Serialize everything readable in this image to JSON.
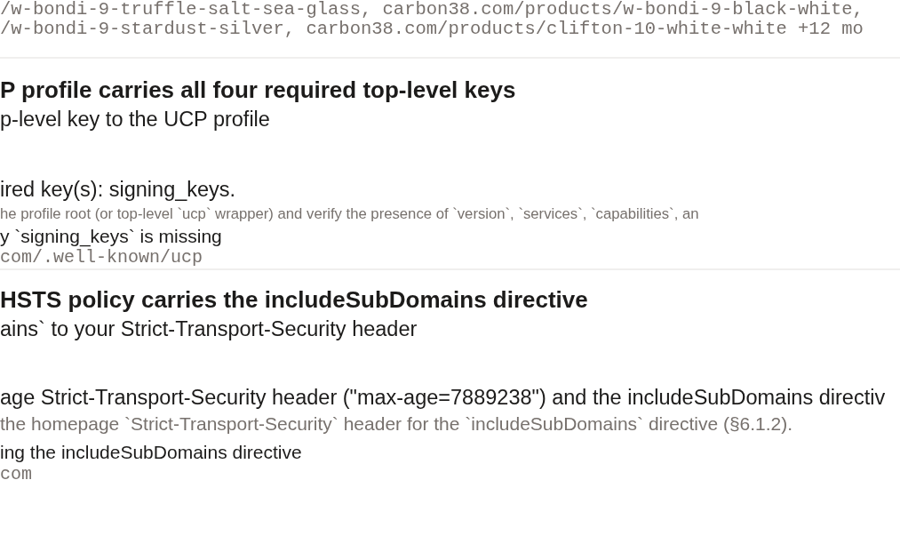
{
  "evidence_urls": [
    "/w-bondi-9-truffle-salt-sea-glass, carbon38.com/products/w-bondi-9-black-white,",
    "/w-bondi-9-stardust-silver, carbon38.com/products/clifton-10-white-white +12 mo"
  ],
  "checks": [
    {
      "title": "P profile carries all four required top-level keys",
      "fix": "p-level key to the UCP profile",
      "finding": "ired key(s): signing_keys.",
      "method": "he profile root (or top-level `ucp` wrapper) and verify the presence of `version`, `services`, `capabilities`, an",
      "evidence": "y `signing_keys` is missing",
      "location": "com/.well-known/ucp"
    },
    {
      "title": "HSTS policy carries the includeSubDomains directive",
      "fix": "ains` to your Strict-Transport-Security header",
      "finding": "age Strict-Transport-Security header (\"max-age=7889238\") and the includeSubDomains directiv",
      "method": "the homepage `Strict-Transport-Security` header for the `includeSubDomains` directive (§6.1.2).",
      "evidence": "ing the includeSubDomains directive",
      "location": "com"
    }
  ]
}
